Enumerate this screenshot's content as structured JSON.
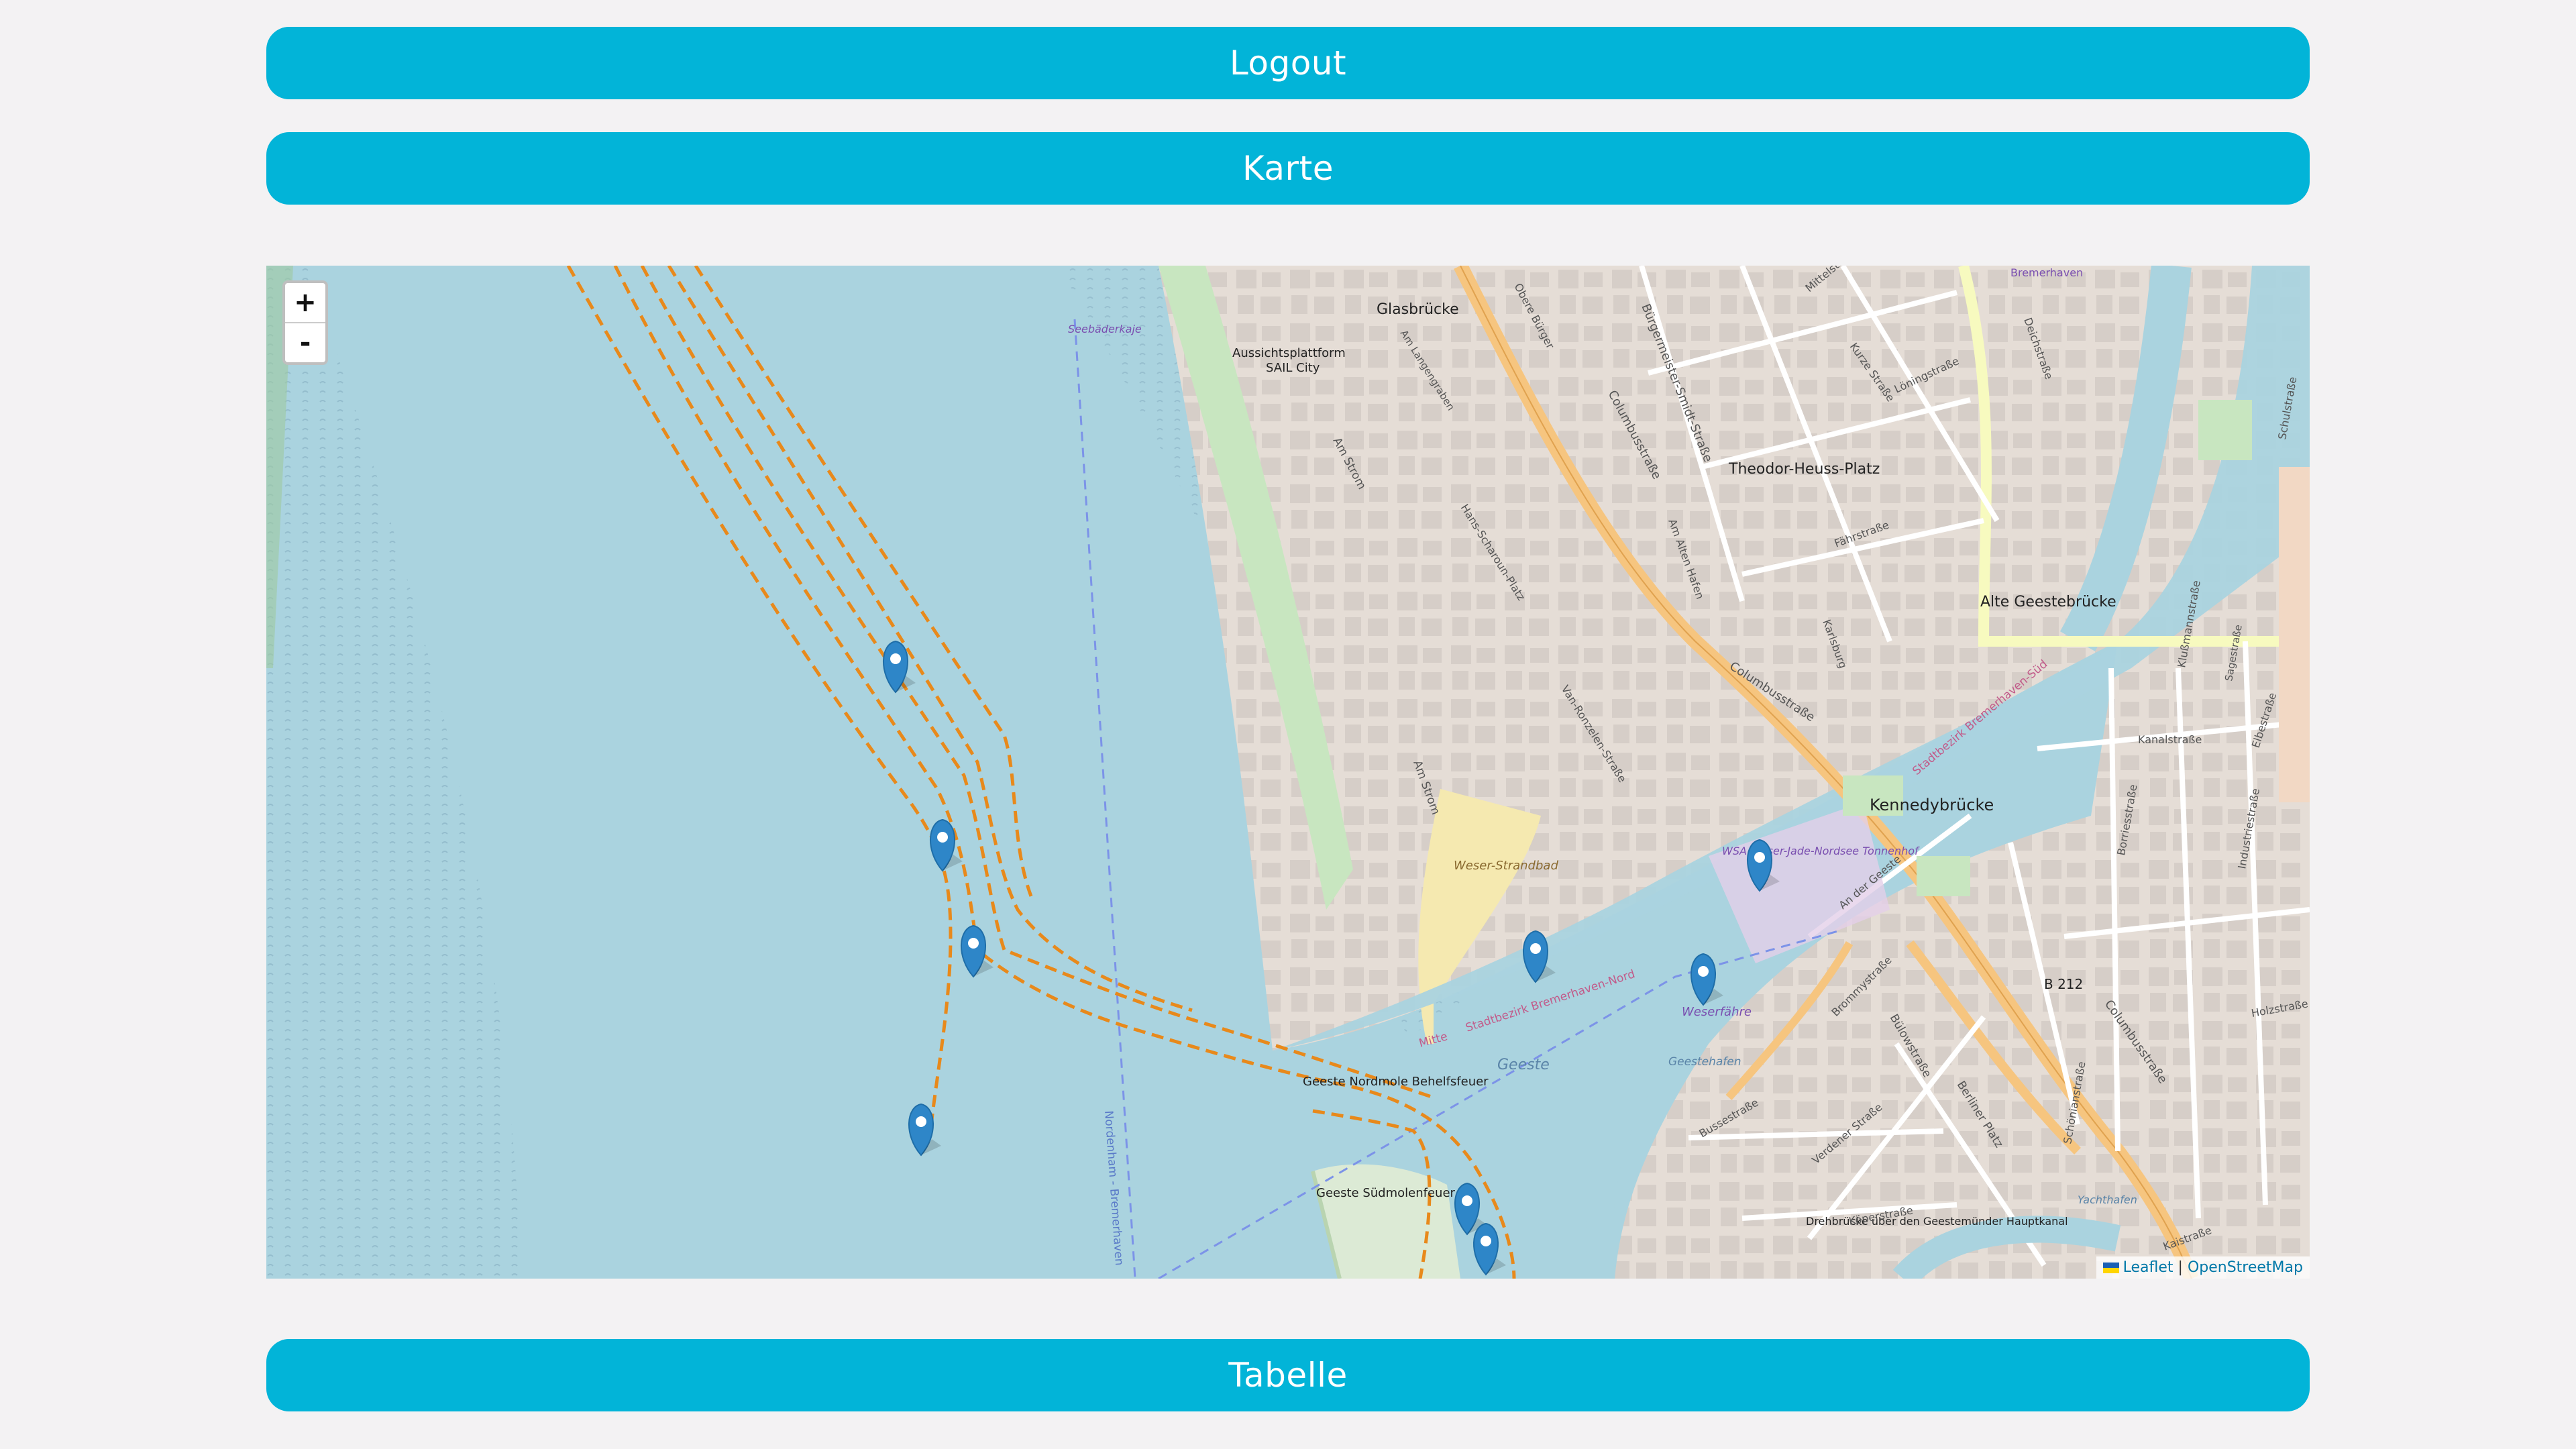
{
  "buttons": {
    "logout": "Logout",
    "map": "Karte",
    "table": "Tabelle"
  },
  "map": {
    "zoom_in": "+",
    "zoom_out": "-",
    "attribution": {
      "leaflet": "Leaflet",
      "separator": "|",
      "osm": "OpenStreetMap"
    },
    "labels": {
      "seebaederkaje": "Seebäderkaje",
      "glasbruecke": "Glasbrücke",
      "aussichtsplattform": "Aussichtsplattform",
      "sail_city": "SAIL City",
      "theodor_heuss_platz": "Theodor-Heuss-Platz",
      "alte_geestebruecke": "Alte Geestebrücke",
      "kennedybruecke": "Kennedybrücke",
      "weser_strandbad": "Weser-Strandbad",
      "wsa_tonnenhof": "WSA Weser-Jade-Nordsee Tonnenhof",
      "weserfaehre": "Weserfähre",
      "geeste": "Geeste",
      "geeste_nordmole": "Geeste Nordmole Behelfsfeuer",
      "geeste_suedmole": "Geeste Südmolenfeuer",
      "geestehafen": "Geestehafen",
      "b212": "B 212",
      "berliner_platz": "Berliner Platz",
      "drehbruecke": "Drehbrücke über den Geestemünder Hauptkanal",
      "columbusstrasse": "Columbusstraße",
      "buergermeister_smidt": "Bürgermeister-Smidt-Straße",
      "am_strom": "Am Strom",
      "mitte": "Mitte",
      "stadtbezirk_nord": "Stadtbezirk Bremerhaven-Nord",
      "stadtbezirk_sued": "Stadtbezirk Bremerhaven-Süd",
      "bremerhaven": "Bremerhaven",
      "nordenham_bremerhaven": "Nordenham - Bremerhaven",
      "yachthafen": "Yachthafen",
      "buergerstrasse": "Bussestraße",
      "buelowstrasse": "Bülowstraße",
      "kaistrasse": "Kaistraße",
      "elbestrasse": "Elbestraße",
      "schulstrasse": "Schulstraße",
      "kurze_strasse": "Kurze Straße",
      "mittelstrasse": "Mittelstraße",
      "kanalstrasse": "Kanalstraße",
      "an_der_geeste": "An der Geeste",
      "hafenstrasse": "Fährstraße",
      "karlsburg": "Karlsburg",
      "am_alten_hafen": "Am Alten Hafen",
      "van_ronzelen": "Van-Ronzelen-Straße",
      "hans_scharoun": "Hans-Scharoun-Platz",
      "berliner_platz_str": "Berliner Platz",
      "lindenstrasse": "Löningstraße",
      "obere_buerger": "Obere Bürger",
      "deichstrasse": "Deichstraße",
      "klussmannstrasse": "Klußmannstraße",
      "industriestrasse": "Industriestraße",
      "holzstrasse": "Holzstraße",
      "verdener_strasse": "Verdener Straße",
      "koperstrasse": "Köperstraße",
      "brommystrasse": "Brommystraße",
      "schoenianstrasse": "Schönianstraße",
      "borriesstrasse": "Borriesstraße",
      "am_langen_graben": "Am Langengraben",
      "sagestrasse": "Sagestraße"
    },
    "marker_icon": "map-pin-icon"
  },
  "colors": {
    "button": "#02b4d8",
    "water": "#aad3df",
    "track": "#e8891b",
    "marker": "#2e86c8"
  }
}
